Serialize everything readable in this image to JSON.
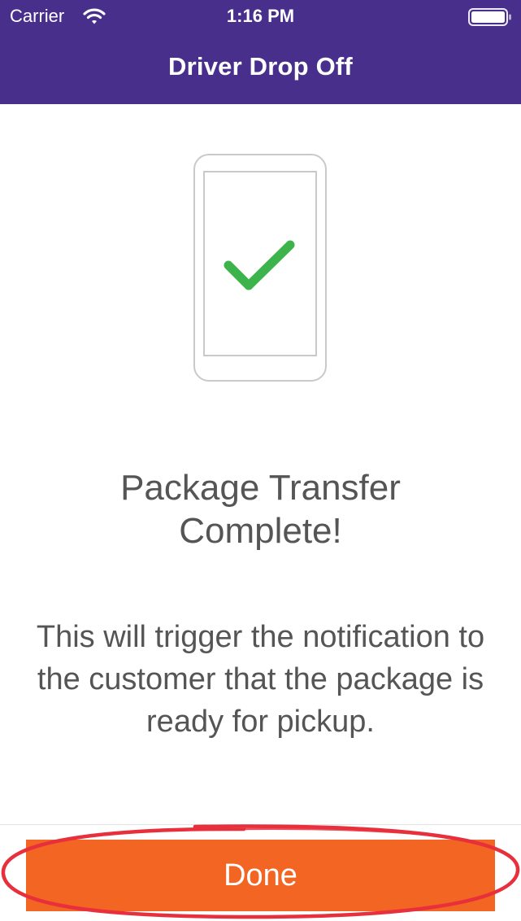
{
  "status_bar": {
    "carrier": "Carrier",
    "time": "1:16 PM",
    "icons": [
      "wifi-icon",
      "battery-icon"
    ]
  },
  "header": {
    "title": "Driver Drop Off"
  },
  "illustration": {
    "icon": "phone-checkmark-icon",
    "check_color": "#3cb44b"
  },
  "content": {
    "title_line1": "Package Transfer",
    "title_line2": "Complete!",
    "description": "This will trigger the notification to the customer that the package is ready for pickup."
  },
  "actions": {
    "done_label": "Done"
  },
  "colors": {
    "header_bg": "#482f8c",
    "button_bg": "#f26522",
    "annotation": "#e8303d",
    "text": "#555555"
  }
}
